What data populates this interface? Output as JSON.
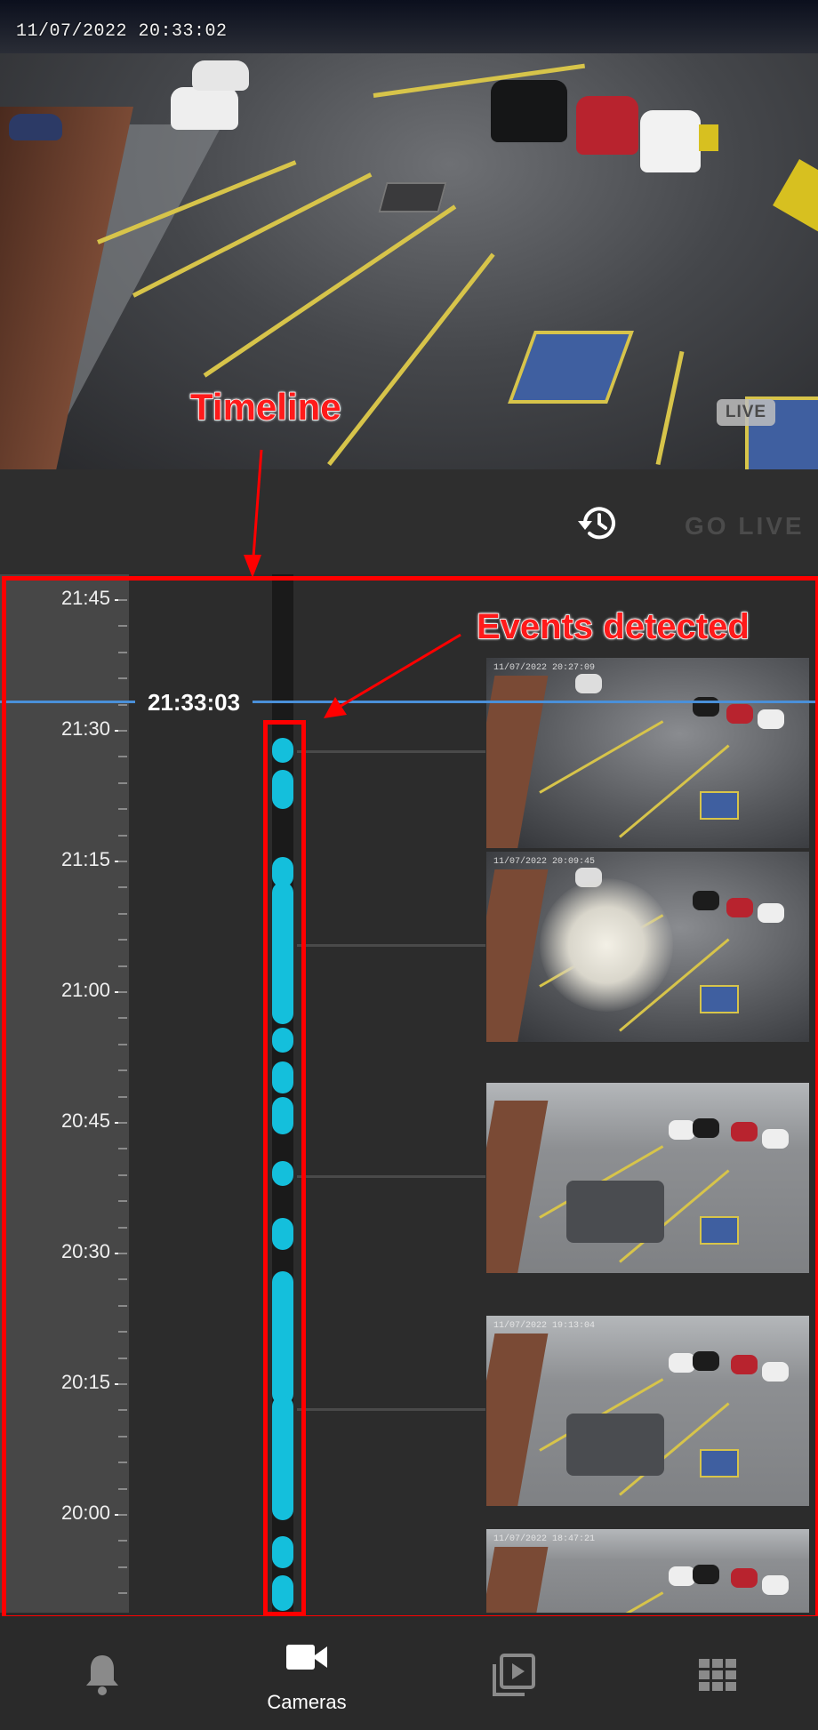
{
  "video": {
    "timestamp": "11/07/2022 20:33:02",
    "live_badge": "LIVE"
  },
  "controls": {
    "history_icon": "history-clock-icon",
    "go_live_label": "GO LIVE"
  },
  "timeline": {
    "current_time": "21:33:03",
    "tick_labels": [
      "21:45",
      "21:30",
      "21:15",
      "21:00",
      "20:45",
      "20:30",
      "20:15",
      "20:00"
    ],
    "thumbnails": [
      {
        "scene": "night",
        "timestamp": "11/07/2022 20:27:09"
      },
      {
        "scene": "night",
        "timestamp": "11/07/2022 20:09:45"
      },
      {
        "scene": "day",
        "timestamp": ""
      },
      {
        "scene": "day",
        "timestamp": "11/07/2022 19:13:04"
      },
      {
        "scene": "day",
        "timestamp": "11/07/2022 18:47:21"
      }
    ]
  },
  "annotations": {
    "timeline_label": "Timeline",
    "events_label": "Events detected",
    "color": "#ff0000"
  },
  "bottom_nav": {
    "items": [
      {
        "icon": "bell-icon",
        "label": ""
      },
      {
        "icon": "video-camera-icon",
        "label": "Cameras"
      },
      {
        "icon": "playlist-play-icon",
        "label": ""
      },
      {
        "icon": "grid-icon",
        "label": ""
      }
    ]
  },
  "colors": {
    "event_dot": "#14bfdc",
    "now_line": "#4a90d9",
    "background": "#2c2c2c"
  }
}
